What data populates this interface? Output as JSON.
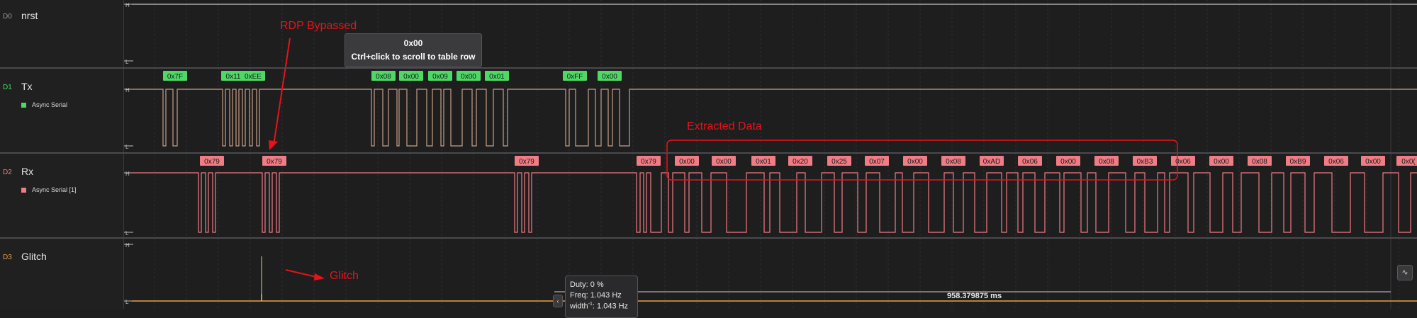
{
  "channels": [
    {
      "id": "D0",
      "name": "nrst",
      "analyzer": "",
      "color": "#9a9a9a"
    },
    {
      "id": "D1",
      "name": "Tx",
      "analyzer": "Async Serial",
      "color": "#4cd964"
    },
    {
      "id": "D2",
      "name": "Rx",
      "analyzer": "Async Serial [1]",
      "color": "#f07c85"
    },
    {
      "id": "D3",
      "name": "Glitch",
      "analyzer": "",
      "color": "#e8a04a"
    }
  ],
  "level_high": "H",
  "level_low": "L",
  "tx_frames": [
    "0x7F",
    "0x11",
    "0xEE",
    "0x08",
    "0x00",
    "0x09",
    "0x00",
    "0x01",
    "0xFF",
    "0x00"
  ],
  "rx_frames": [
    "0x79",
    "0x79",
    "0x79",
    "0x79",
    "0x00",
    "0x00",
    "0x01",
    "0x20",
    "0x25",
    "0x07",
    "0x00",
    "0x08",
    "0xAD",
    "0x06",
    "0x00",
    "0x08",
    "0xB3",
    "0x06",
    "0x00",
    "0x08",
    "0xB9",
    "0x06",
    "0x00",
    "0x0("
  ],
  "tooltip": {
    "value": "0x00",
    "hint": "Ctrl+click to scroll to table row"
  },
  "annotations": {
    "rdp": "RDP Bypassed",
    "extracted": "Extracted Data",
    "glitch": "Glitch"
  },
  "measurement": {
    "duty": "Duty: 0 %",
    "freq": "Freq: 1.043 Hz",
    "width_a": "width",
    "width_sup": "-1",
    "width_b": ": 1.043 Hz"
  },
  "time_readout": "958.379875 ms",
  "time_readout_2": "958.38 ms",
  "colors": {
    "tx": "#4cd964",
    "rx": "#f07c85",
    "tx_trace": "#c7a186",
    "rx_trace": "#f07c85",
    "glitch": "#e8a04a",
    "annotation": "#e8121a"
  },
  "icons": [
    "fit-icon",
    "collapse-icon"
  ]
}
